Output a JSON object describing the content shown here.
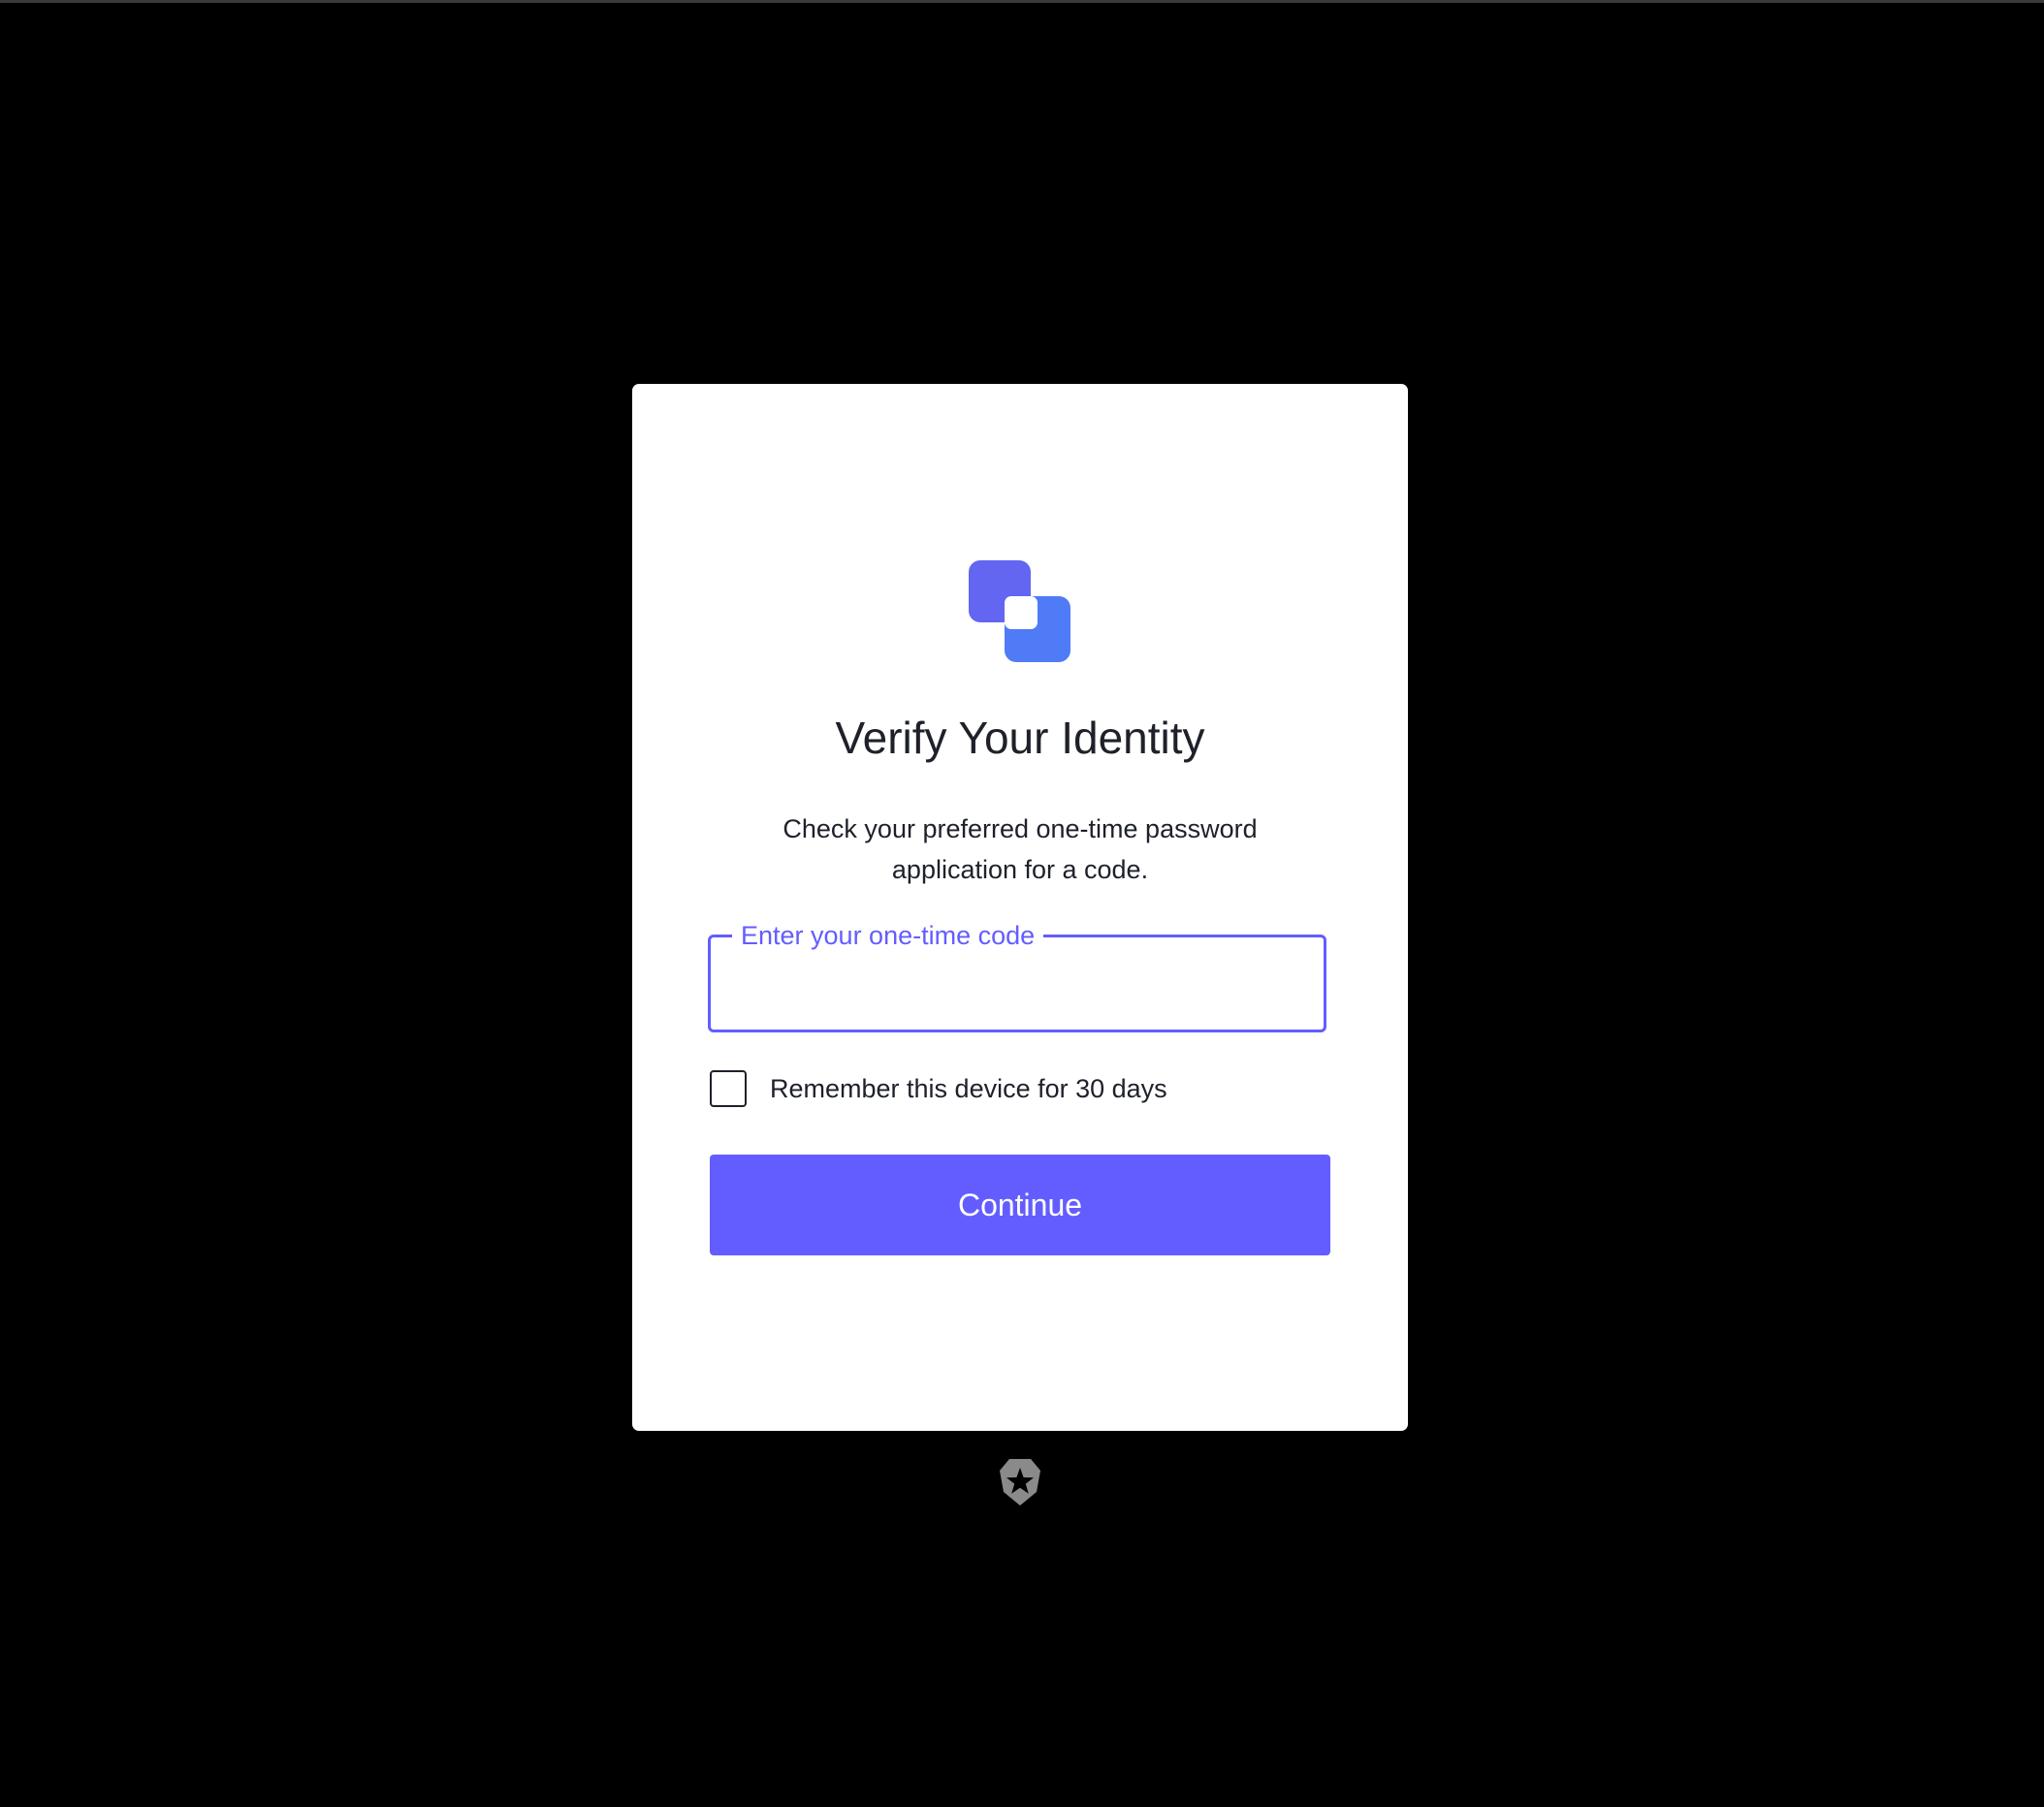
{
  "login": {
    "logo_icon": "brand-logo-squares",
    "title": "Verify Your Identity",
    "description": "Check your preferred one-time password application for a code.",
    "code_field": {
      "label": "Enter your one-time code",
      "value": ""
    },
    "remember": {
      "label": "Remember this device for 30 days",
      "checked": false
    },
    "continue_label": "Continue"
  },
  "footer": {
    "badge_icon": "auth0-shield-icon"
  },
  "colors": {
    "accent": "#635dff",
    "logo_primary": "#6366f1",
    "logo_secondary": "#4f7bf7",
    "text": "#1e212a",
    "background": "#000000",
    "card": "#ffffff"
  }
}
